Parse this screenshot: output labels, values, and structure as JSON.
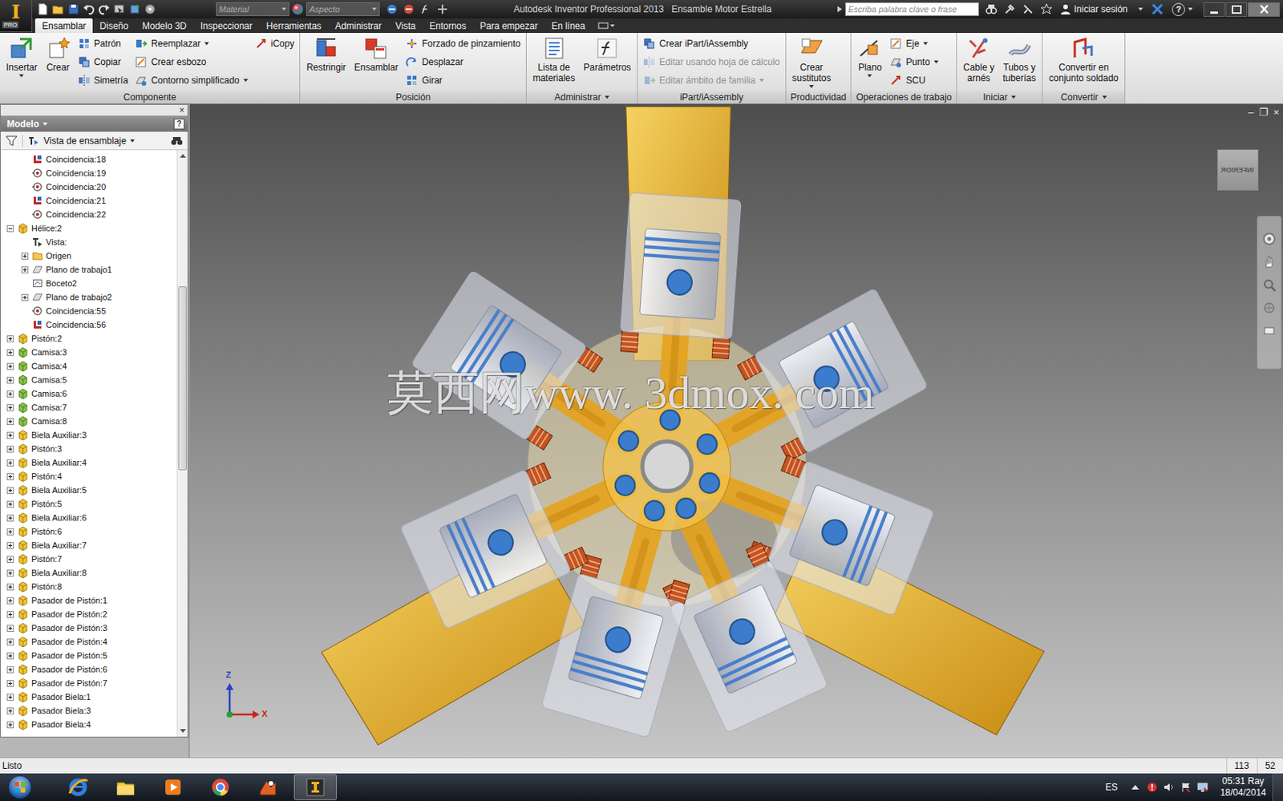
{
  "window": {
    "title": "Autodesk Inventor Professional 2013   Ensamble Motor Estrella",
    "app_letter": "I",
    "app_badge": "PRO",
    "help": "?"
  },
  "quick_access": {
    "material": {
      "label": "Material",
      "disabled": true
    },
    "appearance": {
      "label": "Aspecto",
      "disabled": true
    }
  },
  "search": {
    "placeholder": "Escriba palabra clave o frase"
  },
  "account": {
    "label": "Iniciar sesión"
  },
  "ribbon_tabs": [
    {
      "label": "Ensamblar",
      "selected": true
    },
    {
      "label": "Diseño",
      "selected": false
    },
    {
      "label": "Modelo 3D",
      "selected": false
    },
    {
      "label": "Inspeccionar",
      "selected": false
    },
    {
      "label": "Herramientas",
      "selected": false
    },
    {
      "label": "Administrar",
      "selected": false
    },
    {
      "label": "Vista",
      "selected": false
    },
    {
      "label": "Entornos",
      "selected": false
    },
    {
      "label": "Para empezar",
      "selected": false
    },
    {
      "label": "En línea",
      "selected": false
    }
  ],
  "ribbon_groups": [
    {
      "label": "Componente",
      "dropdown": false,
      "columns": [
        [
          {
            "label": "Insertar",
            "kind": "large",
            "dropdown": true,
            "disabled": false
          }
        ],
        [
          {
            "label": "Crear",
            "kind": "large",
            "dropdown": false,
            "disabled": false
          }
        ],
        [
          {
            "label": "Patrón",
            "kind": "small",
            "dropdown": false,
            "disabled": false
          },
          {
            "label": "Copiar",
            "kind": "small",
            "dropdown": false,
            "disabled": false
          },
          {
            "label": "Simetría",
            "kind": "small",
            "dropdown": false,
            "disabled": false
          }
        ],
        [
          {
            "label": "Reemplazar",
            "kind": "small",
            "dropdown": true,
            "disabled": false
          },
          {
            "label": "Crear esbozo",
            "kind": "small",
            "dropdown": false,
            "disabled": false
          },
          {
            "label": "Contorno simplificado",
            "kind": "small",
            "dropdown": true,
            "disabled": false
          }
        ],
        [
          {
            "label": "iCopy",
            "kind": "small",
            "dropdown": false,
            "disabled": false
          }
        ]
      ]
    },
    {
      "label": "Posición",
      "dropdown": false,
      "columns": [
        [
          {
            "label": "Restringir",
            "kind": "large",
            "dropdown": false,
            "disabled": false
          }
        ],
        [
          {
            "label": "Ensamblar",
            "kind": "large",
            "dropdown": false,
            "disabled": false
          }
        ],
        [
          {
            "label": "Forzado de pinzamiento",
            "kind": "small",
            "dropdown": false,
            "disabled": false
          },
          {
            "label": "Desplazar",
            "kind": "small",
            "dropdown": false,
            "disabled": false
          },
          {
            "label": "Girar",
            "kind": "small",
            "dropdown": false,
            "disabled": false
          }
        ]
      ]
    },
    {
      "label": "Administrar",
      "dropdown": true,
      "columns": [
        [
          {
            "label": "Lista de\nmateriales",
            "kind": "large",
            "dropdown": false,
            "disabled": false
          }
        ],
        [
          {
            "label": "Parámetros",
            "kind": "large",
            "dropdown": false,
            "disabled": false
          }
        ]
      ]
    },
    {
      "label": "iPart/iAssembly",
      "dropdown": false,
      "columns": [
        [
          {
            "label": "Crear iPart/iAssembly",
            "kind": "small",
            "dropdown": false,
            "disabled": false
          },
          {
            "label": "Editar usando hoja de cálculo",
            "kind": "small",
            "dropdown": false,
            "disabled": true
          },
          {
            "label": "Editar ámbito de familia",
            "kind": "small",
            "dropdown": true,
            "disabled": true
          }
        ]
      ]
    },
    {
      "label": "Productividad",
      "dropdown": false,
      "columns": [
        [
          {
            "label": "Crear\nsustitutos",
            "kind": "large",
            "dropdown": true,
            "disabled": false
          }
        ]
      ]
    },
    {
      "label": "Operaciones de trabajo",
      "dropdown": false,
      "columns": [
        [
          {
            "label": "Plano",
            "kind": "large",
            "dropdown": true,
            "disabled": false
          }
        ],
        [
          {
            "label": "Eje",
            "kind": "small",
            "dropdown": true,
            "disabled": false
          },
          {
            "label": "Punto",
            "kind": "small",
            "dropdown": true,
            "disabled": false
          },
          {
            "label": "SCU",
            "kind": "small",
            "dropdown": false,
            "disabled": false
          }
        ]
      ]
    },
    {
      "label": "Iniciar",
      "dropdown": true,
      "columns": [
        [
          {
            "label": "Cable y\narnés",
            "kind": "large",
            "dropdown": false,
            "disabled": false
          }
        ],
        [
          {
            "label": "Tubos y\ntuberías",
            "kind": "large",
            "dropdown": false,
            "disabled": false
          }
        ]
      ]
    },
    {
      "label": "Convertir",
      "dropdown": true,
      "columns": [
        [
          {
            "label": "Convertir en\nconjunto soldado",
            "kind": "large",
            "dropdown": false,
            "disabled": false
          }
        ]
      ]
    }
  ],
  "browser": {
    "close": "×",
    "title": "Modelo",
    "title_dropdown": true,
    "help": "?",
    "view": "Vista de ensamblaje",
    "view_dropdown": true,
    "scroll": 0.33,
    "items": [
      {
        "label": "Coincidencia:18",
        "depth": 1,
        "kind": "mate",
        "expandable": false,
        "expanded": false
      },
      {
        "label": "Coincidencia:19",
        "depth": 1,
        "kind": "insert",
        "expandable": false,
        "expanded": false
      },
      {
        "label": "Coincidencia:20",
        "depth": 1,
        "kind": "insert",
        "expandable": false,
        "expanded": false
      },
      {
        "label": "Coincidencia:21",
        "depth": 1,
        "kind": "mate",
        "expandable": false,
        "expanded": false
      },
      {
        "label": "Coincidencia:22",
        "depth": 1,
        "kind": "insert",
        "expandable": false,
        "expanded": false
      },
      {
        "label": "Hélice:2",
        "depth": 0,
        "kind": "part",
        "expandable": true,
        "expanded": true
      },
      {
        "label": "Vista:",
        "depth": 1,
        "kind": "view",
        "expandable": false,
        "expanded": false
      },
      {
        "label": "Origen",
        "depth": 1,
        "kind": "folder",
        "expandable": true,
        "expanded": false
      },
      {
        "label": "Plano de trabajo1",
        "depth": 1,
        "kind": "plane",
        "expandable": true,
        "expanded": false
      },
      {
        "label": "Boceto2",
        "depth": 1,
        "kind": "sketch",
        "expandable": false,
        "expanded": false
      },
      {
        "label": "Plano de trabajo2",
        "depth": 1,
        "kind": "plane",
        "expandable": true,
        "expanded": false
      },
      {
        "label": "Coincidencia:55",
        "depth": 1,
        "kind": "insert",
        "expandable": false,
        "expanded": false
      },
      {
        "label": "Coincidencia:56",
        "depth": 1,
        "kind": "mate",
        "expandable": false,
        "expanded": false
      },
      {
        "label": "Pistón:2",
        "depth": 0,
        "kind": "part",
        "expandable": true,
        "expanded": false
      },
      {
        "label": "Camisa:3",
        "depth": 0,
        "kind": "part-green",
        "expandable": true,
        "expanded": false
      },
      {
        "label": "Camisa:4",
        "depth": 0,
        "kind": "part-green",
        "expandable": true,
        "expanded": false
      },
      {
        "label": "Camisa:5",
        "depth": 0,
        "kind": "part-green",
        "expandable": true,
        "expanded": false
      },
      {
        "label": "Camisa:6",
        "depth": 0,
        "kind": "part-green",
        "expandable": true,
        "expanded": false
      },
      {
        "label": "Camisa:7",
        "depth": 0,
        "kind": "part-green",
        "expandable": true,
        "expanded": false
      },
      {
        "label": "Camisa:8",
        "depth": 0,
        "kind": "part-green",
        "expandable": true,
        "expanded": false
      },
      {
        "label": "Biela Auxiliar:3",
        "depth": 0,
        "kind": "part",
        "expandable": true,
        "expanded": false
      },
      {
        "label": "Pistón:3",
        "depth": 0,
        "kind": "part",
        "expandable": true,
        "expanded": false
      },
      {
        "label": "Biela Auxiliar:4",
        "depth": 0,
        "kind": "part",
        "expandable": true,
        "expanded": false
      },
      {
        "label": "Pistón:4",
        "depth": 0,
        "kind": "part",
        "expandable": true,
        "expanded": false
      },
      {
        "label": "Biela Auxiliar:5",
        "depth": 0,
        "kind": "part",
        "expandable": true,
        "expanded": false
      },
      {
        "label": "Pistón:5",
        "depth": 0,
        "kind": "part",
        "expandable": true,
        "expanded": false
      },
      {
        "label": "Biela Auxiliar:6",
        "depth": 0,
        "kind": "part",
        "expandable": true,
        "expanded": false
      },
      {
        "label": "Pistón:6",
        "depth": 0,
        "kind": "part",
        "expandable": true,
        "expanded": false
      },
      {
        "label": "Biela Auxiliar:7",
        "depth": 0,
        "kind": "part",
        "expandable": true,
        "expanded": false
      },
      {
        "label": "Pistón:7",
        "depth": 0,
        "kind": "part",
        "expandable": true,
        "expanded": false
      },
      {
        "label": "Biela Auxiliar:8",
        "depth": 0,
        "kind": "part",
        "expandable": true,
        "expanded": false
      },
      {
        "label": "Pistón:8",
        "depth": 0,
        "kind": "part",
        "expandable": true,
        "expanded": false
      },
      {
        "label": "Pasador de Pistón:1",
        "depth": 0,
        "kind": "part",
        "expandable": true,
        "expanded": false
      },
      {
        "label": "Pasador de Pistón:2",
        "depth": 0,
        "kind": "part",
        "expandable": true,
        "expanded": false
      },
      {
        "label": "Pasador de Pistón:3",
        "depth": 0,
        "kind": "part",
        "expandable": true,
        "expanded": false
      },
      {
        "label": "Pasador de Pistón:4",
        "depth": 0,
        "kind": "part",
        "expandable": true,
        "expanded": false
      },
      {
        "label": "Pasador de Pistón:5",
        "depth": 0,
        "kind": "part",
        "expandable": true,
        "expanded": false
      },
      {
        "label": "Pasador de Pistón:6",
        "depth": 0,
        "kind": "part",
        "expandable": true,
        "expanded": false
      },
      {
        "label": "Pasador de Pistón:7",
        "depth": 0,
        "kind": "part",
        "expandable": true,
        "expanded": false
      },
      {
        "label": "Pasador Biela:1",
        "depth": 0,
        "kind": "part",
        "expandable": true,
        "expanded": false
      },
      {
        "label": "Pasador Biela:3",
        "depth": 0,
        "kind": "part",
        "expandable": true,
        "expanded": false
      },
      {
        "label": "Pasador Biela:4",
        "depth": 0,
        "kind": "part",
        "expandable": true,
        "expanded": false
      }
    ]
  },
  "viewport": {
    "controls": [
      "–",
      "❐",
      "×"
    ],
    "watermark": "莫西网www. 3dmox. com",
    "viewcube": "INFERIOR",
    "axes": [
      "Z",
      "X"
    ]
  },
  "status_bar": {
    "text": "Listo",
    "cells": [
      "113",
      "52"
    ]
  },
  "taskbar": {
    "apps": [
      {
        "kind": "ie",
        "selected": false
      },
      {
        "kind": "explorer",
        "selected": false
      },
      {
        "kind": "media",
        "selected": false
      },
      {
        "kind": "chrome",
        "selected": false
      },
      {
        "kind": "app",
        "selected": false
      },
      {
        "kind": "inventor",
        "selected": true
      }
    ],
    "language": "ES",
    "time": "05:31 Ray",
    "date": "18/04/2014"
  }
}
